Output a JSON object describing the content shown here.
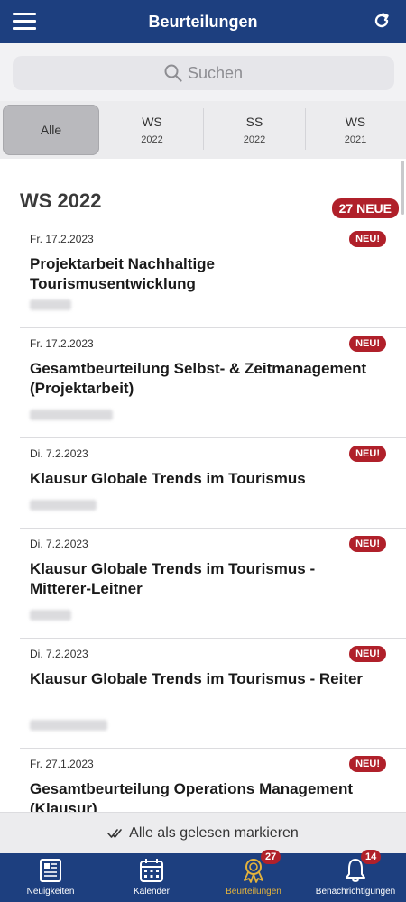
{
  "header": {
    "title": "Beurteilungen",
    "menu_icon": "hamburger-icon",
    "refresh_icon": "refresh-icon"
  },
  "search": {
    "placeholder": "Suchen"
  },
  "segments": [
    {
      "line1": "Alle",
      "line2": ""
    },
    {
      "line1": "WS",
      "line2": "2022"
    },
    {
      "line1": "SS",
      "line2": "2022"
    },
    {
      "line1": "WS",
      "line2": "2021"
    }
  ],
  "section": {
    "title": "WS 2022",
    "badge": "27 NEUE"
  },
  "items": [
    {
      "date": "Fr. 17.2.2023",
      "badge": "NEU!",
      "title": "Projektarbeit Nachhaltige Tourismusentwicklung"
    },
    {
      "date": "Fr. 17.2.2023",
      "badge": "NEU!",
      "title": "Gesamtbeurteilung Selbst- & Zeitmanagement (Projektarbeit)"
    },
    {
      "date": "Di. 7.2.2023",
      "badge": "NEU!",
      "title": "Klausur Globale Trends im Tourismus"
    },
    {
      "date": "Di. 7.2.2023",
      "badge": "NEU!",
      "title": "Klausur Globale Trends im Tourismus - Mitterer-Leitner"
    },
    {
      "date": "Di. 7.2.2023",
      "badge": "NEU!",
      "title": "Klausur Globale Trends im Tourismus - Reiter"
    },
    {
      "date": "Fr. 27.1.2023",
      "badge": "NEU!",
      "title": "Gesamtbeurteilung Operations Management (Klausur)"
    }
  ],
  "mark_all": {
    "label": "Alle als gelesen markieren"
  },
  "nav": [
    {
      "label": "Neuigkeiten",
      "icon": "newspaper-icon",
      "badge": ""
    },
    {
      "label": "Kalender",
      "icon": "calendar-icon",
      "badge": ""
    },
    {
      "label": "Beurteilungen",
      "icon": "award-icon",
      "badge": "27"
    },
    {
      "label": "Benachrichtigungen",
      "icon": "bell-icon",
      "badge": "14"
    }
  ],
  "colors": {
    "primary": "#1d3f7f",
    "badge": "#b0202a",
    "active_nav": "#e3b23c"
  }
}
